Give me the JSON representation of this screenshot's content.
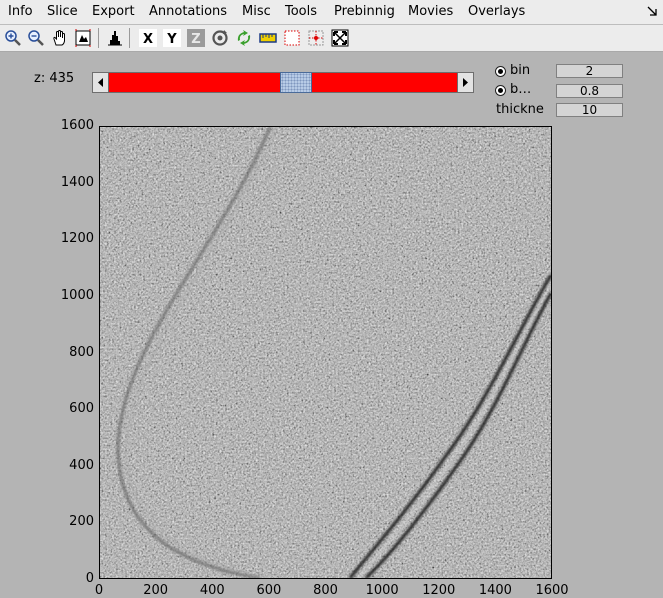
{
  "menubar": {
    "items": [
      "Info",
      "Slice",
      "Export",
      "Annotations",
      "Misc",
      "Tools",
      "Prebinnig",
      "Movies",
      "Overlays"
    ]
  },
  "toolbar": {
    "icons": [
      "zoom-in-icon",
      "zoom-out-icon",
      "pan-hand-icon",
      "fit-image-icon",
      "histogram-icon",
      "x-axis-icon",
      "y-axis-icon",
      "z-axis-icon",
      "rotate-icon",
      "recycle-icon",
      "ruler-icon",
      "dotted-rect-icon",
      "crosshair-icon",
      "fullscreen-icon"
    ],
    "x_label": "X",
    "y_label": "Y",
    "z_label": "Z"
  },
  "slice": {
    "z_label": "z: 435",
    "position_fraction": 0.54
  },
  "params": {
    "bin_label": "bin",
    "bin_value": "2",
    "b_label": "b…",
    "b_value": "0.8",
    "thickness_label": "thickne",
    "thickness_value": "10"
  },
  "chart_data": {
    "type": "heatmap",
    "description_source": "grayscale tomogram slice",
    "title": "",
    "xlabel": "",
    "ylabel": "",
    "xlim": [
      0,
      1600
    ],
    "ylim": [
      0,
      1600
    ],
    "y_ticks": [
      0,
      200,
      400,
      600,
      800,
      1000,
      1200,
      1400,
      1600
    ],
    "x_ticks": [
      0,
      200,
      400,
      600,
      800,
      1000,
      1200,
      1400,
      1600
    ],
    "y_tick_labels": [
      "0",
      "200",
      "400",
      "600",
      "800",
      "1000",
      "1200",
      "1400",
      "1600"
    ],
    "x_tick_labels": [
      "0",
      "200",
      "400",
      "600",
      "800",
      "1000",
      "1200",
      "1400",
      "1600"
    ]
  },
  "colors": {
    "track": "#ff0000",
    "thumb": "#b7cbe6",
    "background": "#b4b4b4"
  }
}
